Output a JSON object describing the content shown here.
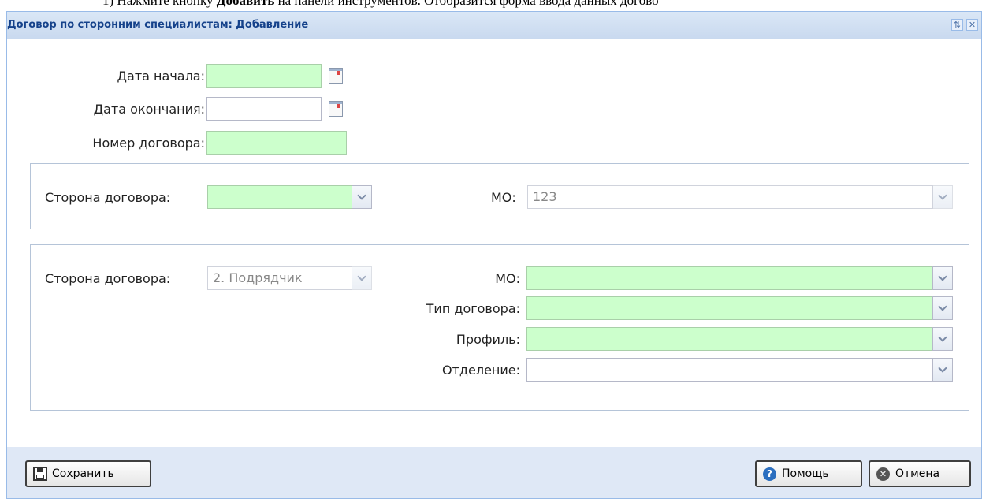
{
  "doc_instruction": {
    "prefix": "1)  Нажмите кнопку ",
    "bold": "Добавить",
    "suffix": " на панели инструментов. Отобразится форма ввода данных догово"
  },
  "window": {
    "title": "Договор по сторонним специалистам: Добавление"
  },
  "form": {
    "start_date_label": "Дата начала:",
    "start_date_value": "",
    "end_date_label": "Дата окончания:",
    "end_date_value": "",
    "contract_number_label": "Номер договора:",
    "contract_number_value": ""
  },
  "party1": {
    "side_label": "Сторона договора:",
    "side_value": "",
    "mo_label": "МО:",
    "mo_value": "123"
  },
  "party2": {
    "side_label": "Сторона договора:",
    "side_value": "2. Подрядчик",
    "mo_label": "МО:",
    "mo_value": "",
    "contract_type_label": "Тип договора:",
    "contract_type_value": "",
    "profile_label": "Профиль:",
    "profile_value": "",
    "department_label": "Отделение:",
    "department_value": ""
  },
  "buttons": {
    "save": "Сохранить",
    "help": "Помощь",
    "cancel": "Отмена"
  },
  "colors": {
    "required_field": "#ccffcc",
    "title_text": "#15428b",
    "panel_bg": "#dfe8f6"
  }
}
